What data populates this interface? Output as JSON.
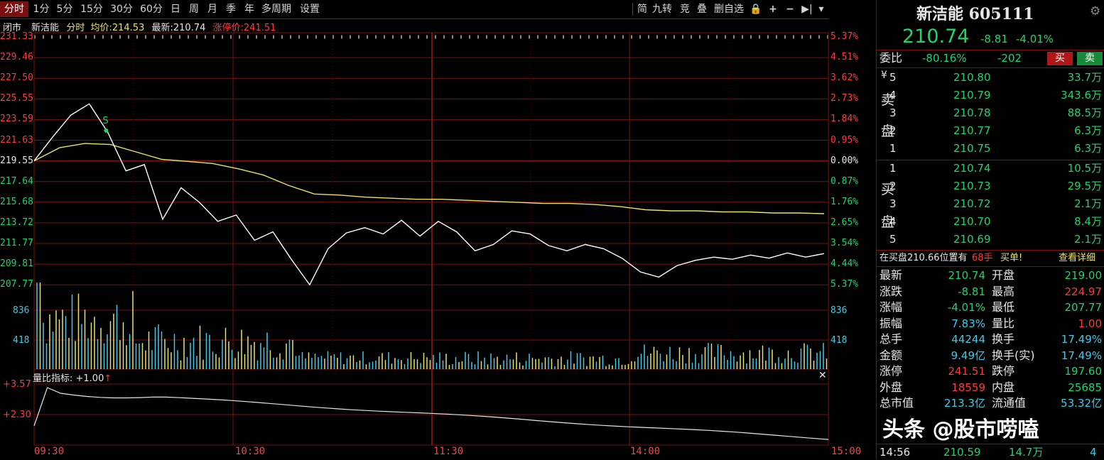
{
  "toolbar": {
    "tabs": [
      "分时",
      "1分",
      "5分",
      "15分",
      "30分",
      "60分",
      "日",
      "周",
      "月",
      "季",
      "年",
      "多周期",
      "设置"
    ],
    "tools": [
      "简",
      "九转",
      "竞",
      "叠",
      "删自选",
      "🔒",
      "+",
      "−",
      "▶|",
      "▾"
    ]
  },
  "chart_header": {
    "status": "闭市",
    "stock_name": "新洁能",
    "mode": "分时",
    "avg_label": "均价:",
    "avg_value": "214.53",
    "latest_label": "最新:",
    "latest_value": "210.74",
    "limit_label": "涨停价:",
    "limit_value": "241.51"
  },
  "price_axis_left": [
    "231.33",
    "229.46",
    "227.50",
    "225.55",
    "223.59",
    "221.63",
    "219.55",
    "217.64",
    "215.68",
    "213.72",
    "211.77",
    "209.81",
    "207.77"
  ],
  "pct_axis_right": [
    "5.37%",
    "4.51%",
    "3.62%",
    "2.73%",
    "1.84%",
    "0.95%",
    "0.00%",
    "0.87%",
    "1.76%",
    "2.65%",
    "3.54%",
    "4.44%",
    "5.37%"
  ],
  "volume_axis": [
    "836",
    "418"
  ],
  "volume_axis_right": [
    "836",
    "418"
  ],
  "indicator": {
    "label": "量比指标: +1.00",
    "arrow": "↑",
    "axis": [
      "+3.57",
      "+2.30"
    ]
  },
  "time_axis": [
    "09:30",
    "10:30",
    "11:30",
    "14:00",
    "15:00"
  ],
  "signal_marker": "S",
  "chart_data": {
    "type": "line",
    "x": [
      "09:30",
      "10:30",
      "11:30",
      "14:00",
      "15:00"
    ],
    "prev_close": 219.55,
    "ylim": [
      207.77,
      231.33
    ],
    "series": [
      {
        "name": "最新",
        "values": [
          219.55,
          221.8,
          223.9,
          224.97,
          222.3,
          218.6,
          219.2,
          214.0,
          217.0,
          215.6,
          213.8,
          214.4,
          212.0,
          212.8,
          210.2,
          207.77,
          211.2,
          212.7,
          213.2,
          212.6,
          213.9,
          212.4,
          213.8,
          212.8,
          211.0,
          211.6,
          212.9,
          212.6,
          211.5,
          211.0,
          211.6,
          211.2,
          210.3,
          209.0,
          208.5,
          209.6,
          210.1,
          210.4,
          210.2,
          210.6,
          210.3,
          210.8,
          210.4,
          210.74
        ]
      },
      {
        "name": "均价",
        "values": [
          219.55,
          220.8,
          221.2,
          221.1,
          220.4,
          219.7,
          219.5,
          219.3,
          218.8,
          218.2,
          217.2,
          216.4,
          216.3,
          216.1,
          216.0,
          215.9,
          215.9,
          215.8,
          215.7,
          215.6,
          215.5,
          215.5,
          215.4,
          215.2,
          214.9,
          214.8,
          214.8,
          214.7,
          214.7,
          214.6,
          214.6,
          214.53
        ]
      }
    ]
  },
  "panel": {
    "title": "新洁能 605111",
    "price": "210.74",
    "change": "-8.81",
    "change_pct": "-4.01%",
    "weibi_label": "委比",
    "weibi_pct": "-80.16%",
    "weibi_diff": "-202",
    "buy_btn": "买",
    "sell_btn": "卖",
    "sell_label": [
      "卖",
      "盘"
    ],
    "buy_label": [
      "买",
      "盘"
    ],
    "sell_orders": [
      {
        "level": "5",
        "price": "210.80",
        "vol": "33.7万"
      },
      {
        "level": "4",
        "price": "210.79",
        "vol": "343.6万"
      },
      {
        "level": "3",
        "price": "210.78",
        "vol": "88.5万"
      },
      {
        "level": "2",
        "price": "210.77",
        "vol": "6.3万"
      },
      {
        "level": "1",
        "price": "210.75",
        "vol": "6.3万"
      }
    ],
    "buy_orders": [
      {
        "level": "1",
        "price": "210.74",
        "vol": "10.5万"
      },
      {
        "level": "2",
        "price": "210.73",
        "vol": "29.5万"
      },
      {
        "level": "3",
        "price": "210.72",
        "vol": "2.1万"
      },
      {
        "level": "4",
        "price": "210.70",
        "vol": "8.4万"
      },
      {
        "level": "5",
        "price": "210.69",
        "vol": "2.1万"
      }
    ],
    "notice_prefix": "在买盘210.66位置有",
    "notice_qty": "68手",
    "notice_tag": "买单!",
    "notice_link": "查看详细",
    "stats": [
      {
        "k1": "最新",
        "v1": "210.74",
        "c1": "green",
        "k2": "开盘",
        "v2": "219.00",
        "c2": "green"
      },
      {
        "k1": "涨跌",
        "v1": "-8.81",
        "c1": "green",
        "k2": "最高",
        "v2": "224.97",
        "c2": "red"
      },
      {
        "k1": "涨幅",
        "v1": "-4.01%",
        "c1": "green",
        "k2": "最低",
        "v2": "207.77",
        "c2": "green"
      },
      {
        "k1": "振幅",
        "v1": "7.83%",
        "c1": "cyan",
        "k2": "量比",
        "v2": "1.00",
        "c2": "red"
      },
      {
        "k1": "总手",
        "v1": "44244",
        "c1": "cyan",
        "k2": "换手",
        "v2": "17.49%",
        "c2": "cyan"
      },
      {
        "k1": "金额",
        "v1": "9.49亿",
        "c1": "cyan",
        "k2": "换手(实)",
        "v2": "17.49%",
        "c2": "cyan"
      },
      {
        "k1": "涨停",
        "v1": "241.51",
        "c1": "red",
        "k2": "跌停",
        "v2": "197.60",
        "c2": "green"
      },
      {
        "k1": "外盘",
        "v1": "18559",
        "c1": "red",
        "k2": "内盘",
        "v2": "25685",
        "c2": "green"
      },
      {
        "k1": "总市值",
        "v1": "213.3亿",
        "c1": "cyan",
        "k2": "流通值",
        "v2": "53.32亿",
        "c2": "cyan"
      }
    ],
    "last_trade": {
      "time": "14:56",
      "price": "210.59",
      "vol": "14.7万",
      "count": "4"
    },
    "watermark": "头条 @股市唠嗑"
  },
  "colors": {
    "up": "#ff3a3a",
    "down": "#22d36a",
    "grid": "#7a1010",
    "avg": "#e8e26a",
    "price": "#ffffff",
    "volume": "#3ecbe8"
  }
}
